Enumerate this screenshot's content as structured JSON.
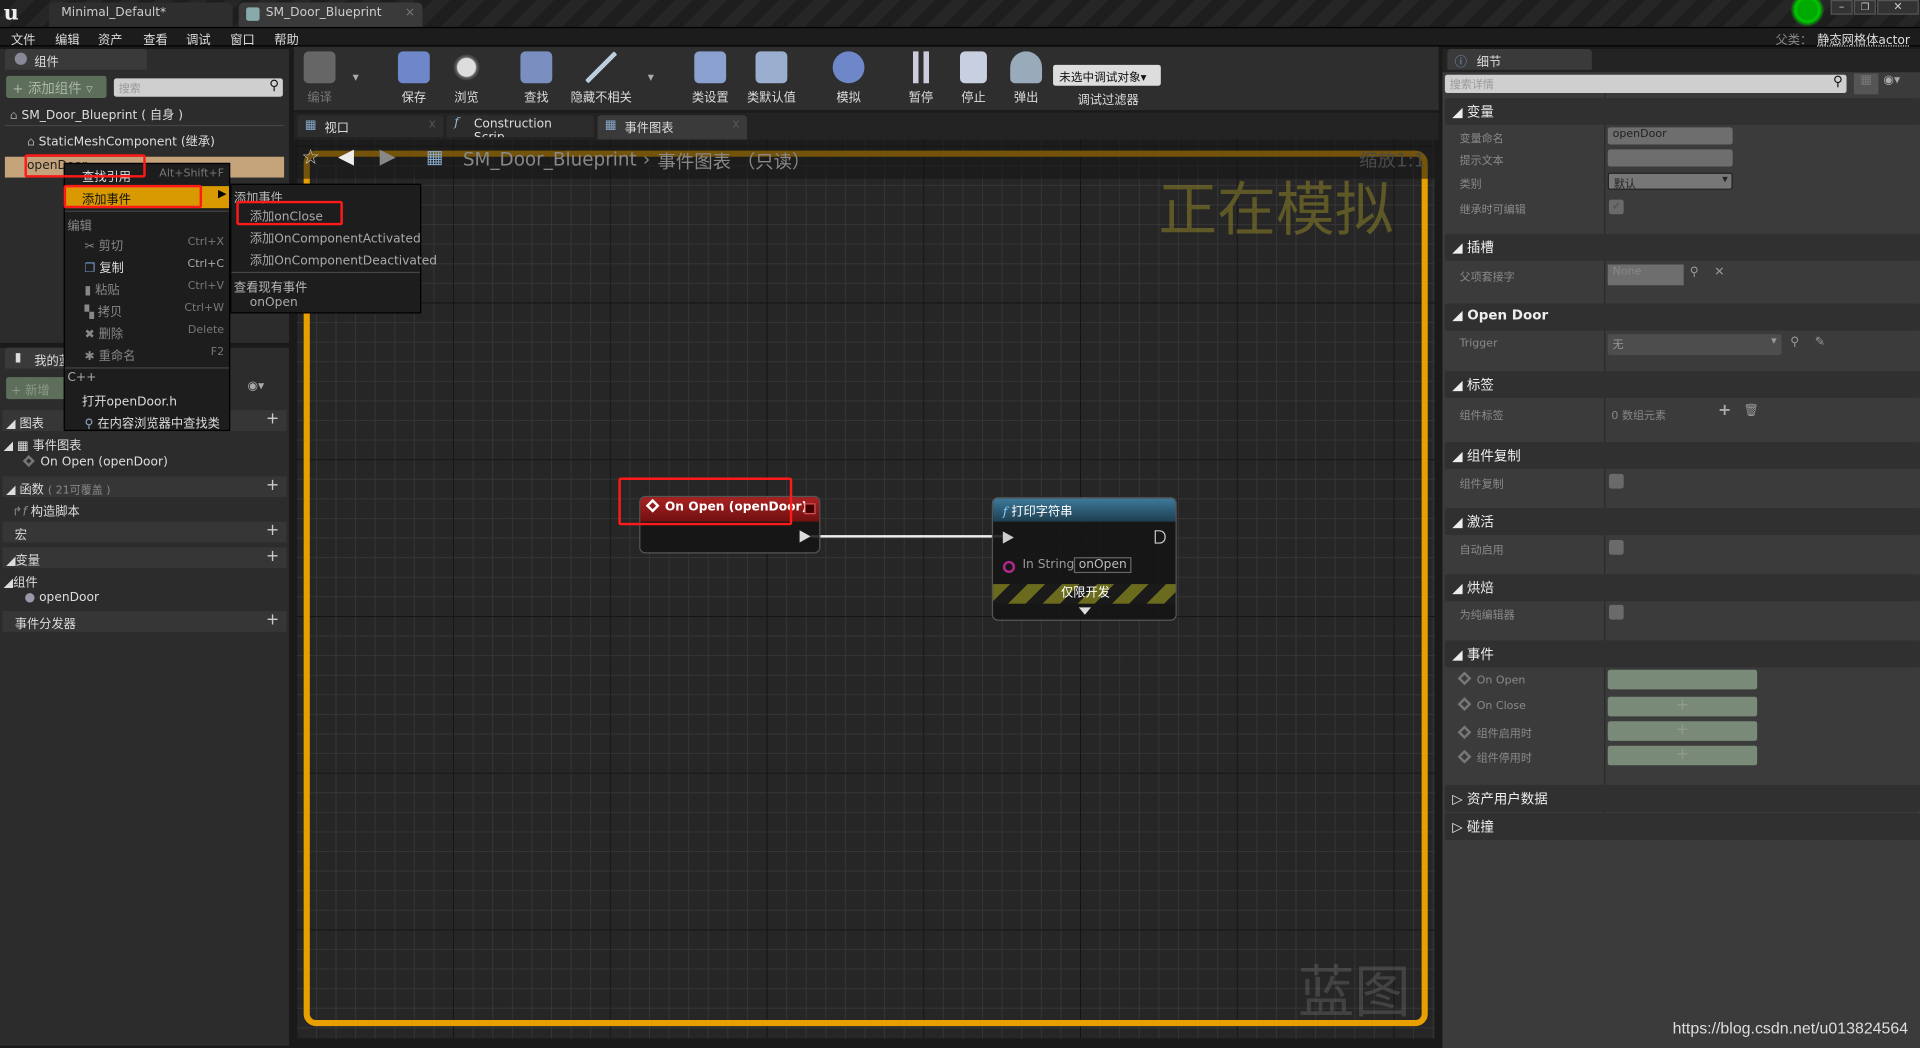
{
  "window": {
    "logo": "u",
    "tabs": [
      "Minimal_Default*",
      "SM_Door_Blueprint"
    ],
    "parent_label": "父类：",
    "parent_value": "静态网格体actor",
    "controls": [
      "minimize",
      "restore",
      "close"
    ]
  },
  "menu": [
    "文件",
    "编辑",
    "资产",
    "查看",
    "调试",
    "窗口",
    "帮助"
  ],
  "components_panel": {
    "tab": "组件",
    "add_button": "添加组件",
    "search_placeholder": "搜索",
    "tree": [
      "SM_Door_Blueprint ( 自身 )",
      "StaticMeshComponent (继承)",
      "openDoor"
    ]
  },
  "context_menu": {
    "find_refs": "查找引用",
    "find_refs_shortcut": "Alt+Shift+F",
    "add_event": "添加事件",
    "edit_header": "编辑",
    "edit_items": [
      {
        "label": "剪切",
        "shortcut": "Ctrl+X"
      },
      {
        "label": "复制",
        "shortcut": "Ctrl+C"
      },
      {
        "label": "粘贴",
        "shortcut": "Ctrl+V"
      },
      {
        "label": "拷贝",
        "shortcut": "Ctrl+W"
      },
      {
        "label": "删除",
        "shortcut": "Delete"
      },
      {
        "label": "重命名",
        "shortcut": "F2"
      }
    ],
    "cpp_header": "C++",
    "open_header": "打开openDoor.h",
    "find_in_browser": "在内容浏览器中查找类"
  },
  "submenu": {
    "header": "添加事件",
    "items": [
      "添加onClose",
      "添加OnComponentActivated",
      "添加OnComponentDeactivated"
    ],
    "existing_header": "查看现有事件",
    "existing": [
      "onOpen"
    ]
  },
  "my_blueprint": {
    "tab": "我的蓝图",
    "new_button": "新增",
    "sections": {
      "graphs": "图表",
      "event_graph": "事件图表",
      "on_open": "On Open (openDoor)",
      "functions": "函数",
      "functions_note": "( 21可覆盖 )",
      "construction": "构造脚本",
      "macros": "宏",
      "variables": "变量",
      "components": "组件",
      "component_item": "openDoor",
      "dispatchers": "事件分发器"
    }
  },
  "toolbar": {
    "compile": "编译",
    "save": "保存",
    "browse": "浏览",
    "find": "查找",
    "hide_unrelated": "隐藏不相关",
    "class_settings": "类设置",
    "class_defaults": "类默认值",
    "simulate": "模拟",
    "pause": "暂停",
    "stop": "停止",
    "eject": "弹出",
    "debug_select": "未选中调试对象",
    "debug_filter": "调试过滤器"
  },
  "doc_tabs": [
    "视口",
    "Construction Scrip",
    "事件图表"
  ],
  "graph": {
    "breadcrumb_root": "SM_Door_Blueprint",
    "breadcrumb_current": "事件图表 （只读）",
    "zoom": "缩放1:1",
    "simulating": "正在模拟",
    "watermark": "蓝图",
    "event_node": {
      "title": "On Open (openDoor)",
      "color": "#8a1a1a"
    },
    "print_node": {
      "title": "打印字符串",
      "pin_label": "In String",
      "pin_value": "onOpen",
      "dev_only": "仅限开发",
      "color": "#2e5f7a"
    },
    "border_color": "#e8a000"
  },
  "details": {
    "tab": "细节",
    "search_placeholder": "搜索详情",
    "variable": {
      "header": "变量",
      "name_label": "变量命名",
      "name_value": "openDoor",
      "tooltip_label": "提示文本",
      "category_label": "类别",
      "category_value": "默认",
      "editable_label": "继承时可编辑",
      "editable": true
    },
    "sockets": {
      "header": "插槽",
      "parent_label": "父项套接字",
      "parent_value": "None"
    },
    "open_door": {
      "header": "Open Door",
      "trigger_label": "Trigger",
      "trigger_value": "无"
    },
    "tags": {
      "header": "标签",
      "label": "组件标签",
      "value": "0 数组元素"
    },
    "replication": {
      "header": "组件复制",
      "label": "组件复制",
      "checked": false
    },
    "activation": {
      "header": "激活",
      "label": "自动启用",
      "checked": false
    },
    "cooking": {
      "header": "烘焙",
      "label": "为纯编辑器",
      "checked": false
    },
    "events": {
      "header": "事件",
      "items": [
        "On Open",
        "On Close",
        "组件启用时",
        "组件停用时"
      ]
    },
    "asset_user_data": "资产用户数据",
    "collision": "碰撞"
  },
  "watermark_url": "https://blog.csdn.net/u013824564"
}
